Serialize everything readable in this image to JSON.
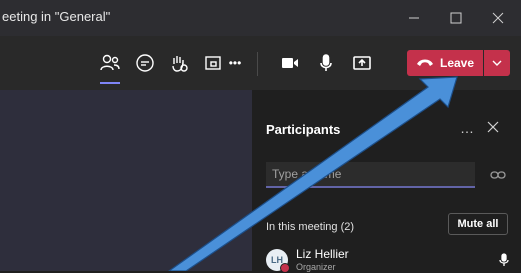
{
  "window": {
    "title": "eeting in \"General\"",
    "minimize_icon": "minimize-icon",
    "maximize_icon": "maximize-icon",
    "close_icon": "close-icon"
  },
  "toolbar": {
    "icons": [
      "participants-icon",
      "chat-icon",
      "raise-hand-icon",
      "rooms-icon",
      "more-icon",
      "camera-icon",
      "mic-icon",
      "share-icon"
    ],
    "more_label": "•••",
    "leave_label": "Leave",
    "leave_color": "#c4314b",
    "accent": "#7f85f5"
  },
  "panel": {
    "title": "Participants",
    "more_label": "…",
    "search": {
      "placeholder": "Type a name",
      "value": ""
    },
    "section_label": "In this meeting (2)",
    "mute_all_label": "Mute all",
    "participants": [
      {
        "initials": "LH",
        "name": "Liz Hellier",
        "role": "Organizer"
      }
    ]
  },
  "annotation": {
    "color": "#4a90d9"
  }
}
